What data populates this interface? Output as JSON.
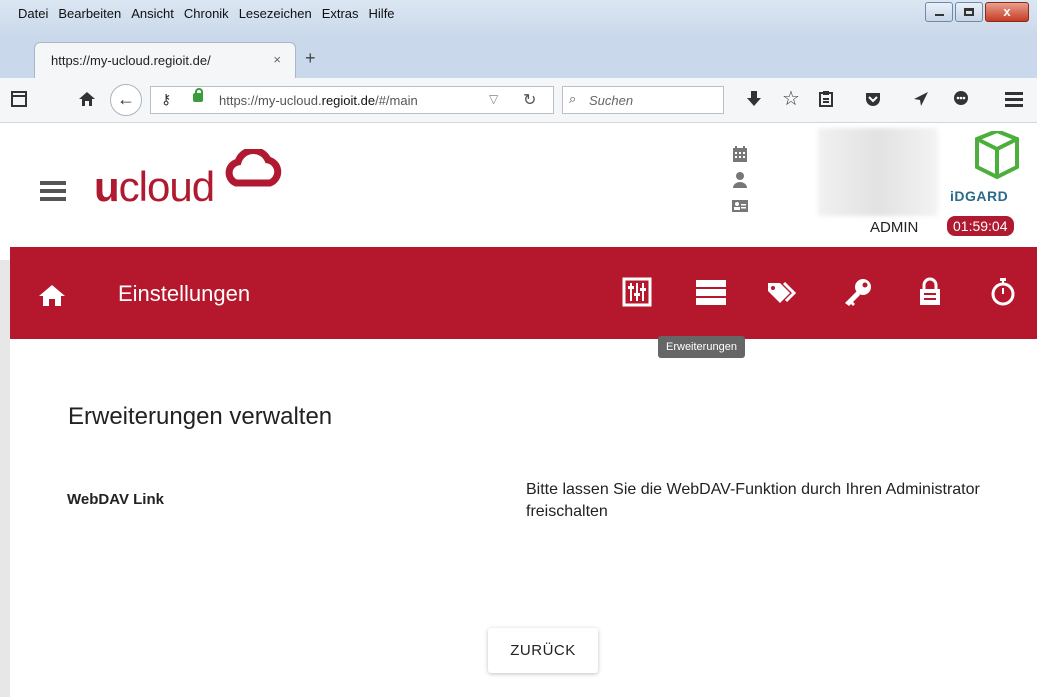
{
  "browser": {
    "menu": [
      "Datei",
      "Bearbeiten",
      "Ansicht",
      "Chronik",
      "Lesezeichen",
      "Extras",
      "Hilfe"
    ],
    "tab_title": "https://my-ucloud.regioit.de/",
    "tab_close": "×",
    "new_tab": "+",
    "url_prefix": "https://my-ucloud.",
    "url_domain": "regioit.de",
    "url_path": "/#/main",
    "search_placeholder": "Suchen"
  },
  "header": {
    "logo_bold": "u",
    "logo_rest": "cloud",
    "user_label": "ADMIN",
    "session_timer": "01:59:04",
    "brand_right": "iDGARD"
  },
  "navbar": {
    "title": "Einstellungen",
    "tooltip": "Erweiterungen"
  },
  "content": {
    "heading": "Erweiterungen verwalten",
    "field_label": "WebDAV Link",
    "message": "Bitte lassen Sie die WebDAV-Funktion durch Ihren Administrator freischalten",
    "back_button": "ZURÜCK"
  },
  "colors": {
    "brand_red": "#b5172d",
    "idgard_green": "#4cae3b"
  }
}
